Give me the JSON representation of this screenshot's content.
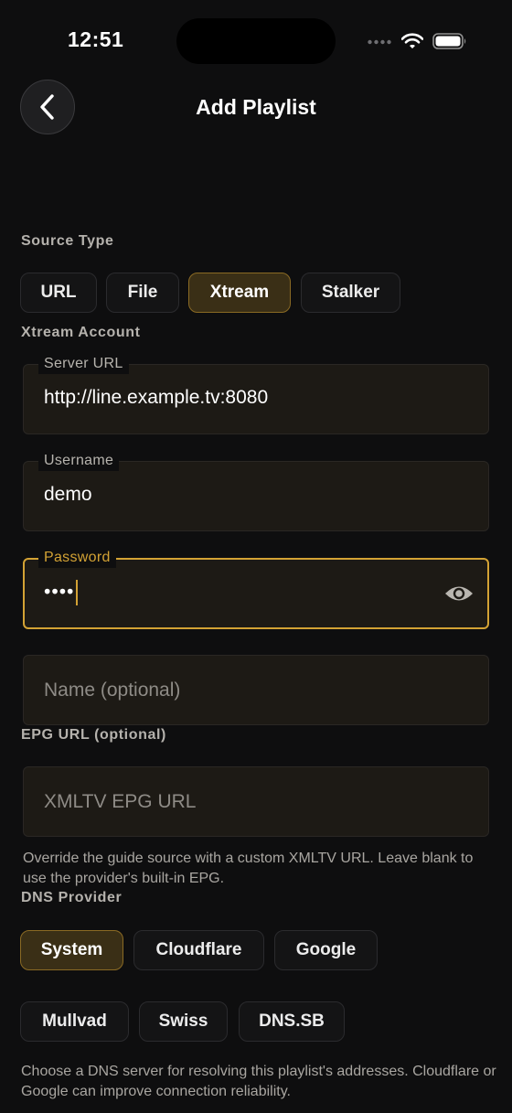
{
  "status_bar": {
    "time": "12:51"
  },
  "header": {
    "title": "Add Playlist"
  },
  "source_type": {
    "label": "Source Type",
    "options": [
      {
        "label": "URL",
        "selected": false
      },
      {
        "label": "File",
        "selected": false
      },
      {
        "label": "Xtream",
        "selected": true
      },
      {
        "label": "Stalker",
        "selected": false
      }
    ]
  },
  "xtream_account": {
    "label": "Xtream Account",
    "server_url": {
      "label": "Server URL",
      "value": "http://line.example.tv:8080"
    },
    "username": {
      "label": "Username",
      "value": "demo"
    },
    "password": {
      "label": "Password",
      "value": "••••"
    },
    "name": {
      "placeholder": "Name (optional)"
    }
  },
  "epg": {
    "label": "EPG URL (optional)",
    "placeholder": "XMLTV EPG URL",
    "helper": "Override the guide source with a custom XMLTV URL. Leave blank to use the provider's built-in EPG."
  },
  "dns": {
    "label": "DNS Provider",
    "options": [
      {
        "label": "System",
        "selected": true
      },
      {
        "label": "Cloudflare",
        "selected": false
      },
      {
        "label": "Google",
        "selected": false
      },
      {
        "label": "Mullvad",
        "selected": false
      },
      {
        "label": "Swiss",
        "selected": false
      },
      {
        "label": "DNS.SB",
        "selected": false
      }
    ],
    "helper": "Choose a DNS server for resolving this playlist's addresses. Cloudflare or Google can improve connection reliability."
  },
  "colors": {
    "background": "#0e0e0f",
    "accent": "#d3a234",
    "field_bg": "#1d1a15",
    "chip_selected_bg": "#3a2f16"
  },
  "icons": {
    "back": "chevron-left-icon",
    "reveal": "eye-icon",
    "wifi": "wifi-icon",
    "battery": "battery-icon",
    "signal": "signal-icon"
  }
}
